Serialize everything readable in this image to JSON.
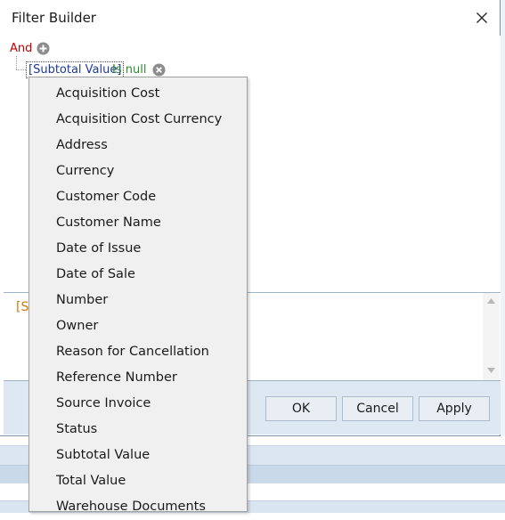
{
  "dialog": {
    "title": "Filter Builder"
  },
  "filter": {
    "group_operator": "And",
    "condition": {
      "field": "[Subtotal Value]",
      "operator": "Is null"
    }
  },
  "text_editor": {
    "content": "[S"
  },
  "footer": {
    "ok_label": "OK",
    "cancel_label": "Cancel",
    "apply_label": "Apply"
  },
  "field_dropdown": {
    "items": [
      "Acquisition Cost",
      "Acquisition Cost Currency",
      "Address",
      "Currency",
      "Customer Code",
      "Customer Name",
      "Date of Issue",
      "Date of Sale",
      "Number",
      "Owner",
      "Reason for Cancellation",
      "Reference Number",
      "Source Invoice",
      "Status",
      "Subtotal Value",
      "Total Value",
      "Warehouse Documents"
    ]
  },
  "colors": {
    "group_operator": "#c00000",
    "field_name": "#1f3a9a",
    "operator": "#2e8b2e",
    "text_content": "#d4780a",
    "footer_bg": "#dde8f3",
    "dropdown_bg": "#f0f0f0"
  }
}
